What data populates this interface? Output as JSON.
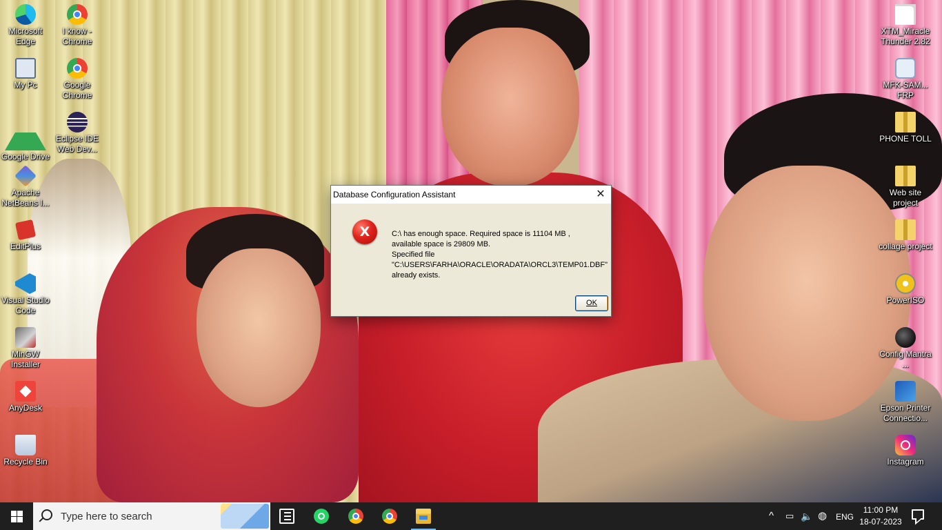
{
  "desktop": {
    "left_icons": [
      {
        "label": "Microsoft Edge",
        "icon": "edge-icon"
      },
      {
        "label": "My Pc",
        "icon": "computer-icon"
      },
      {
        "label": "Google Drive",
        "icon": "google-drive-icon"
      },
      {
        "label": "Apache NetBeans I...",
        "icon": "netbeans-icon"
      },
      {
        "label": "EditPlus",
        "icon": "editplus-icon"
      },
      {
        "label": "Visual Studio Code",
        "icon": "vscode-icon"
      },
      {
        "label": "MinGW Installer",
        "icon": "mingw-icon"
      },
      {
        "label": "AnyDesk",
        "icon": "anydesk-icon"
      },
      {
        "label": "Recycle Bin",
        "icon": "recycle-bin-icon"
      }
    ],
    "second_col_icons": [
      {
        "label": "I know - Chrome",
        "icon": "chrome-icon"
      },
      {
        "label": "Google Chrome",
        "icon": "chrome-icon"
      },
      {
        "label": "Eclipse IDE Web Dev...",
        "icon": "eclipse-icon"
      }
    ],
    "right_icons": [
      {
        "label": "XTM_Miracle Thunder 2.82",
        "icon": "file-icon"
      },
      {
        "label": "MFK-SAM... FRP",
        "icon": "usb-icon"
      },
      {
        "label": "PHONE TOLL",
        "icon": "zip-icon"
      },
      {
        "label": "Web site project",
        "icon": "zip-icon"
      },
      {
        "label": "collage project",
        "icon": "zip-icon"
      },
      {
        "label": "PowerISO",
        "icon": "poweriso-icon"
      },
      {
        "label": "Config Mantra ...",
        "icon": "config-mantra-icon"
      },
      {
        "label": "Epson Printer Connectio...",
        "icon": "epson-icon"
      },
      {
        "label": "Instagram",
        "icon": "instagram-icon"
      }
    ]
  },
  "dialog": {
    "title": "Database Configuration Assistant",
    "close_symbol": "✕",
    "icon_symbol": "X",
    "message_lines": [
      "C:\\ has enough space. Required space is 11104 MB ,",
      "available space is 29809 MB.",
      "Specified file",
      "\"C:\\USERS\\FARHA\\ORACLE\\ORADATA\\ORCL3\\TEMP01.DBF\"",
      "already exists."
    ],
    "ok_label": "OK"
  },
  "taskbar": {
    "search_placeholder": "Type here to search",
    "apps": [
      {
        "name": "task-view",
        "icon": "task-view-icon"
      },
      {
        "name": "whatsapp",
        "icon": "whatsapp-icon"
      },
      {
        "name": "chrome-1",
        "icon": "chrome-icon"
      },
      {
        "name": "chrome-2",
        "icon": "chrome-icon"
      },
      {
        "name": "file-explorer",
        "icon": "folder-icon",
        "active": true
      }
    ],
    "tray": {
      "chevron": "^",
      "language": "ENG",
      "time": "11:00 PM",
      "date": "18-07-2023"
    }
  }
}
